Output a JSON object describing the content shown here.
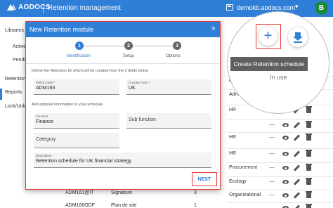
{
  "header": {
    "logo": "AODOCS",
    "app_title": "Retention management",
    "tenant": "demokb.aodocs.com",
    "chevron": "▾",
    "avatar": "B"
  },
  "sidebar": {
    "items": [
      {
        "label": "Libraries"
      },
      {
        "label": "Active l"
      },
      {
        "label": "Pendin"
      },
      {
        "label": "Retention S"
      },
      {
        "label": "Reports"
      },
      {
        "label": "Lock/Unloc"
      }
    ]
  },
  "table": {
    "rows": [
      {
        "category": "HR",
        "dash": "—"
      },
      {
        "category": "Administration",
        "dash": "—"
      },
      {
        "category": "HR",
        "dash": "—"
      },
      {
        "category": "",
        "dash": "—"
      },
      {
        "category": "HR",
        "dash": "—"
      },
      {
        "category": "HR",
        "dash": "—"
      },
      {
        "category": "Procurement",
        "dash": "—"
      },
      {
        "category": "Ecology",
        "dash": "—"
      },
      {
        "category": "Organizational",
        "dash": "—"
      }
    ],
    "bottom_rows": [
      {
        "code": "ADM161@IT",
        "name": "Signature",
        "count": "3"
      },
      {
        "code": "ADM166ODF",
        "name": "Plan de site",
        "count": "1"
      }
    ]
  },
  "modal": {
    "title": "New Retention module",
    "close": "×",
    "steps": [
      {
        "number": "1",
        "label": "Identification"
      },
      {
        "number": "2",
        "label": "Setup"
      },
      {
        "number": "3",
        "label": "Options"
      }
    ],
    "hint_required": "Define the Retention ID which will be created from the 2 fields below",
    "hint_optional": "Add optional information to your schedule",
    "fields": {
      "policy_code": {
        "label": "Policy Code *",
        "value": "ADM163"
      },
      "country": {
        "label": "Country Form *",
        "value": "UK"
      },
      "function": {
        "label": "Function",
        "value": "Finance"
      },
      "sub_function": {
        "placeholder": "Sub function"
      },
      "category": {
        "placeholder": "Category"
      },
      "description": {
        "label": "Description",
        "value": "Retention schedule for UK financial strategy"
      }
    },
    "next_label": "NEXT"
  },
  "zoom": {
    "add_symbol": "+",
    "tooltip": "Create Retention schedule",
    "in_use": "In use"
  },
  "colors": {
    "primary": "#2f7ed8",
    "highlight": "#e53935",
    "avatar": "#1b8a3c"
  }
}
